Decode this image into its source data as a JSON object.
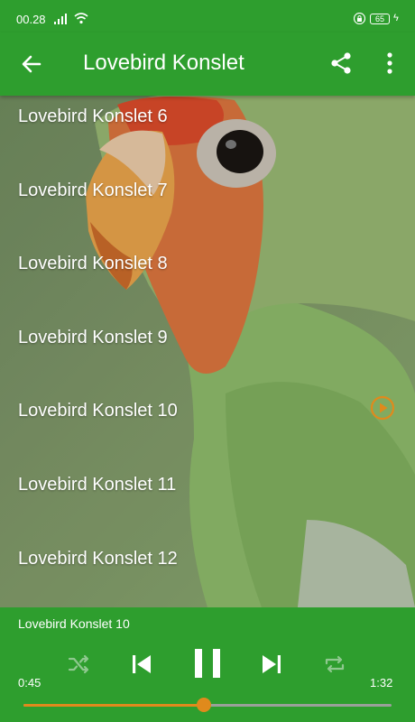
{
  "status_bar": {
    "time": "00.28",
    "battery": "65"
  },
  "app_bar": {
    "title": "Lovebird Konslet"
  },
  "tracks": [
    {
      "label": "Lovebird Konslet 6",
      "playing": false
    },
    {
      "label": "Lovebird Konslet 7",
      "playing": false
    },
    {
      "label": "Lovebird Konslet 8",
      "playing": false
    },
    {
      "label": "Lovebird Konslet 9",
      "playing": false
    },
    {
      "label": "Lovebird Konslet 10",
      "playing": true
    },
    {
      "label": "Lovebird Konslet 11",
      "playing": false
    },
    {
      "label": "Lovebird Konslet 12",
      "playing": false
    }
  ],
  "player": {
    "now_playing": "Lovebird Konslet 10",
    "elapsed": "0:45",
    "duration": "1:32",
    "progress": 0.49
  },
  "colors": {
    "bar": "#2e9e2e",
    "accent": "#e08a1c"
  }
}
